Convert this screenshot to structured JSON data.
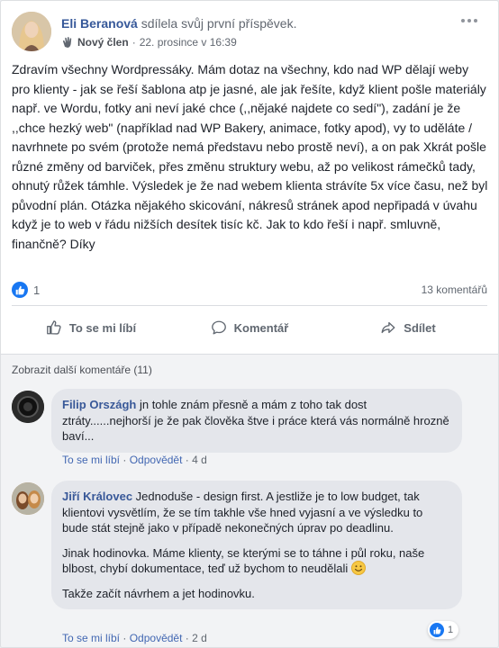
{
  "post": {
    "author": "Eli Beranová",
    "action_text": "sdílela svůj první příspěvek.",
    "badge": "Nový člen",
    "separator": "·",
    "date": "22. prosince v 16:39",
    "body": "Zdravím všechny Wordpressáky. Mám dotaz na všechny, kdo nad WP dělají weby pro klienty - jak se řeší šablona atp je jasné, ale jak řešíte, když klient pošle materiály např. ve Wordu, fotky ani neví jaké chce (,,nějaké najdete co sedí\"), zadání je že ,,chce hezký web\" (například nad WP Bakery, animace, fotky apod), vy to uděláte / navrhnete po svém (protože nemá představu nebo prostě neví), a on pak Xkrát pošle různé změny od barviček, přes změnu struktury webu, až po velikost rámečků tady, ohnutý růžek támhle. Výsledek je že nad webem klienta strávíte 5x více času, než byl původní plán. Otázka nějakého skicování, nákresů stránek apod nepřipadá v úvahu když je to web v řádu nižších desítek tisíc kč. Jak to kdo řeší i např. smluvně, finančně? Díky",
    "like_count": "1",
    "comment_count": "13 komentářů"
  },
  "actions": {
    "like": "To se mi líbí",
    "comment": "Komentář",
    "share": "Sdílet"
  },
  "comments_section": {
    "more_label": "Zobrazit další komentáře (11)",
    "items": [
      {
        "author": "Filip Országh",
        "text": "jn tohle znám přesně a mám z toho tak dost ztráty......nejhorší je že pak člověka štve i práce která vás normálně hrozně baví...",
        "like": "To se mi líbí",
        "reply": "Odpovědět",
        "time": "4 d"
      },
      {
        "author": "Jiří Královec",
        "paragraph1": "Jednoduše - design first. A jestliže je to low budget, tak klientovi vysvětlím, že se tím takhle vše hned vyjasní a ve výsledku to bude stát stejně jako v případě nekonečných úprav po deadlinu.",
        "paragraph2": "Jinak hodinovka. Máme klienty, se kterými se to táhne i půl roku, naše blbost, chybí dokumentace, teď už bychom to neudělali",
        "paragraph3": "Takže začít návrhem a jet hodinovku.",
        "reaction_count": "1",
        "like": "To se mi líbí",
        "reply": "Odpovědět",
        "time": "2 d"
      }
    ]
  },
  "colors": {
    "link": "#365899",
    "like_blue": "#1877f2",
    "bubble": "#e4e6eb"
  }
}
